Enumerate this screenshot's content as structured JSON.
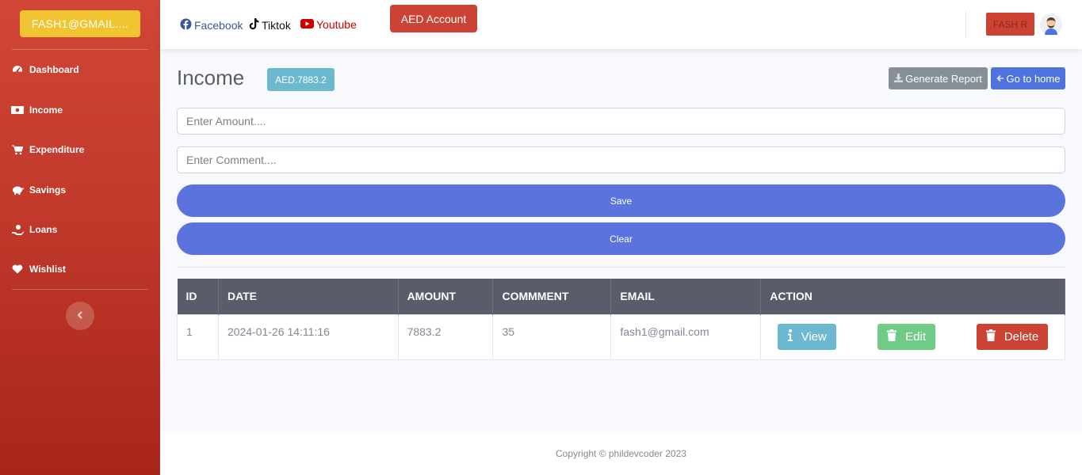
{
  "sidebar": {
    "brand": "FASH1@GMAIL....",
    "items": [
      {
        "label": "Dashboard",
        "icon": "tachometer-icon"
      },
      {
        "label": "Income",
        "icon": "money-bill-icon"
      },
      {
        "label": "Expenditure",
        "icon": "cart-icon"
      },
      {
        "label": "Savings",
        "icon": "piggy-bank-icon"
      },
      {
        "label": "Loans",
        "icon": "hand-holding-usd-icon"
      },
      {
        "label": "Wishlist",
        "icon": "heart-icon"
      }
    ],
    "toggle_icon": "chevron-left-icon"
  },
  "topbar": {
    "links": [
      {
        "label": "Facebook",
        "icon": "facebook-icon",
        "color": "#3b5998"
      },
      {
        "label": "Tiktok",
        "icon": "tiktok-icon",
        "color": "#000000"
      },
      {
        "label": "Youtube",
        "icon": "youtube-icon",
        "color": "#cc0000"
      }
    ],
    "account_button": "AED Account",
    "user_name": "FASH R"
  },
  "main": {
    "title": "Income",
    "balance": "AED.7883.2",
    "generate_report": "Generate Report",
    "go_home": "Go to home",
    "amount_placeholder": "Enter Amount....",
    "comment_placeholder": "Enter Comment....",
    "save_label": "Save",
    "clear_label": "Clear"
  },
  "table": {
    "headers": [
      "ID",
      "DATE",
      "AMOUNT",
      "COMMMENT",
      "EMAIL",
      "ACTION"
    ],
    "rows": [
      {
        "id": "1",
        "date": "2024-01-26 14:11:16",
        "amount": "7883.2",
        "comment": "35",
        "email": "fash1@gmail.com"
      }
    ],
    "actions": {
      "view": "View",
      "edit": "Edit",
      "delete": "Delete"
    }
  },
  "footer": {
    "text": "Copyright © phildevcoder 2023"
  },
  "colors": {
    "sidebar": "#c0392b",
    "primary": "#4e73df",
    "danger": "#cc4233",
    "info": "#6cb8d1",
    "success": "#6fcb86",
    "warning": "#f0c531"
  }
}
